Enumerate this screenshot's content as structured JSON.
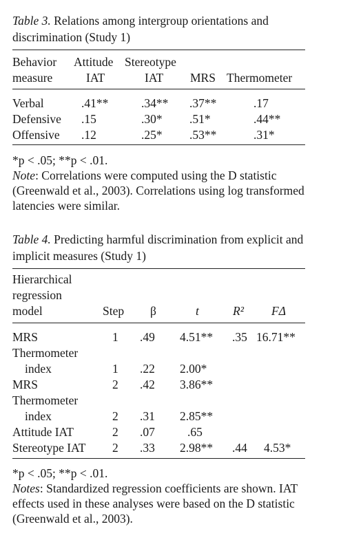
{
  "table3": {
    "caption_label": "Table 3.",
    "caption_text": "Relations among intergroup orientations and discrimination (Study 1)",
    "headers": {
      "col1_line1": "Behavior",
      "col1_line2": "measure",
      "col2_line1": "Attitude",
      "col2_line2": "IAT",
      "col3_line1": "Stereotype",
      "col3_line2": "IAT",
      "col4": "MRS",
      "col5": "Thermometer"
    },
    "rows": [
      {
        "measure": "Verbal",
        "attitude_iat": ".41**",
        "stereotype_iat": ".34**",
        "mrs": ".37**",
        "thermometer": ".17"
      },
      {
        "measure": "Defensive",
        "attitude_iat": ".15",
        "stereotype_iat": ".30*",
        "mrs": ".51*",
        "thermometer": ".44**"
      },
      {
        "measure": "Offensive",
        "attitude_iat": ".12",
        "stereotype_iat": ".25*",
        "mrs": ".53**",
        "thermometer": ".31*"
      }
    ],
    "sig_note": "*p < .05; **p < .01.",
    "note_label": "Note",
    "note_text": ": Correlations were computed using the D statistic (Greenwald et al., 2003). Correlations using log transformed latencies were similar."
  },
  "table4": {
    "caption_label": "Table 4.",
    "caption_text": "Predicting harmful discrimination from explicit and implicit measures (Study 1)",
    "headers": {
      "model_line1": "Hierarchical",
      "model_line2": "regression",
      "model_line3": "model",
      "step": "Step",
      "beta": "β",
      "t": "t",
      "r2": "R²",
      "fdelta": "FΔ"
    },
    "rows": [
      {
        "model": "MRS",
        "step": "1",
        "beta": ".49",
        "t": "4.51**",
        "r2": ".35",
        "fdelta": "16.71**"
      },
      {
        "model": "Thermometer",
        "step": "",
        "beta": "",
        "t": "",
        "r2": "",
        "fdelta": ""
      },
      {
        "model": "index",
        "step": "1",
        "beta": ".22",
        "t": "2.00*",
        "r2": "",
        "fdelta": ""
      },
      {
        "model": "MRS",
        "step": "2",
        "beta": ".42",
        "t": "3.86**",
        "r2": "",
        "fdelta": ""
      },
      {
        "model": "Thermometer",
        "step": "",
        "beta": "",
        "t": "",
        "r2": "",
        "fdelta": ""
      },
      {
        "model": "index",
        "step": "2",
        "beta": ".31",
        "t": "2.85**",
        "r2": "",
        "fdelta": ""
      },
      {
        "model": "Attitude IAT",
        "step": "2",
        "beta": ".07",
        "t": ".65",
        "r2": "",
        "fdelta": ""
      },
      {
        "model": "Stereotype IAT",
        "step": "2",
        "beta": ".33",
        "t": "2.98**",
        "r2": ".44",
        "fdelta": "4.53*"
      }
    ],
    "sig_note": "*p < .05; **p < .01.",
    "note_label": "Notes",
    "note_text": ": Standardized regression coefficients are shown. IAT effects used in these analyses were based on the D statistic (Greenwald et al., 2003)."
  }
}
